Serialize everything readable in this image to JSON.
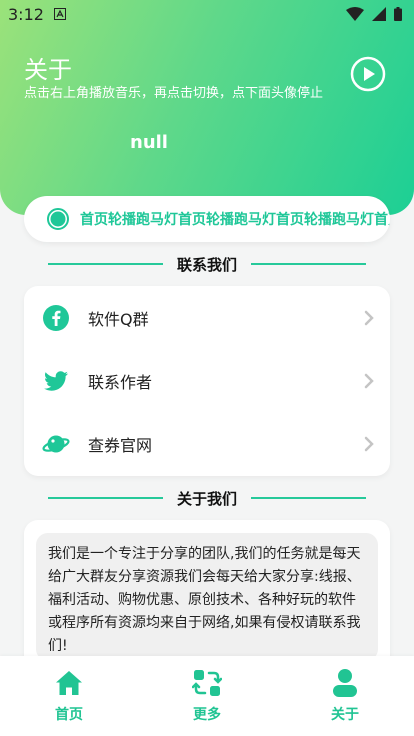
{
  "status": {
    "time": "3:12"
  },
  "header": {
    "title": "关于",
    "subtitle": "点击右上角播放音乐，再点击切换，点下面头像停止",
    "name": "null"
  },
  "marquee": {
    "text": "首页轮播跑马灯首页轮播跑马灯首页轮播跑马灯首页轮播跑马灯"
  },
  "contact_section": {
    "title": "联系我们",
    "items": [
      {
        "label": "软件Q群",
        "icon": "facebook-icon"
      },
      {
        "label": "联系作者",
        "icon": "twitter-icon"
      },
      {
        "label": "查券官网",
        "icon": "planet-icon"
      }
    ]
  },
  "about_section": {
    "title": "关于我们",
    "text": "我们是一个专注于分享的团队,我们的任务就是每天给广大群友分享资源我们会每天给大家分享:线报、福利活动、购物优惠、原创技术、各种好玩的软件或程序所有资源均来自于网络,如果有侵权请联系我们!"
  },
  "nav": {
    "items": [
      {
        "label": "首页",
        "icon": "home-icon"
      },
      {
        "label": "更多",
        "icon": "switch-icon"
      },
      {
        "label": "关于",
        "icon": "user-icon"
      }
    ]
  },
  "colors": {
    "accent": "#21c493",
    "gradient_start": "#9be27a",
    "gradient_end": "#1ccf95"
  }
}
